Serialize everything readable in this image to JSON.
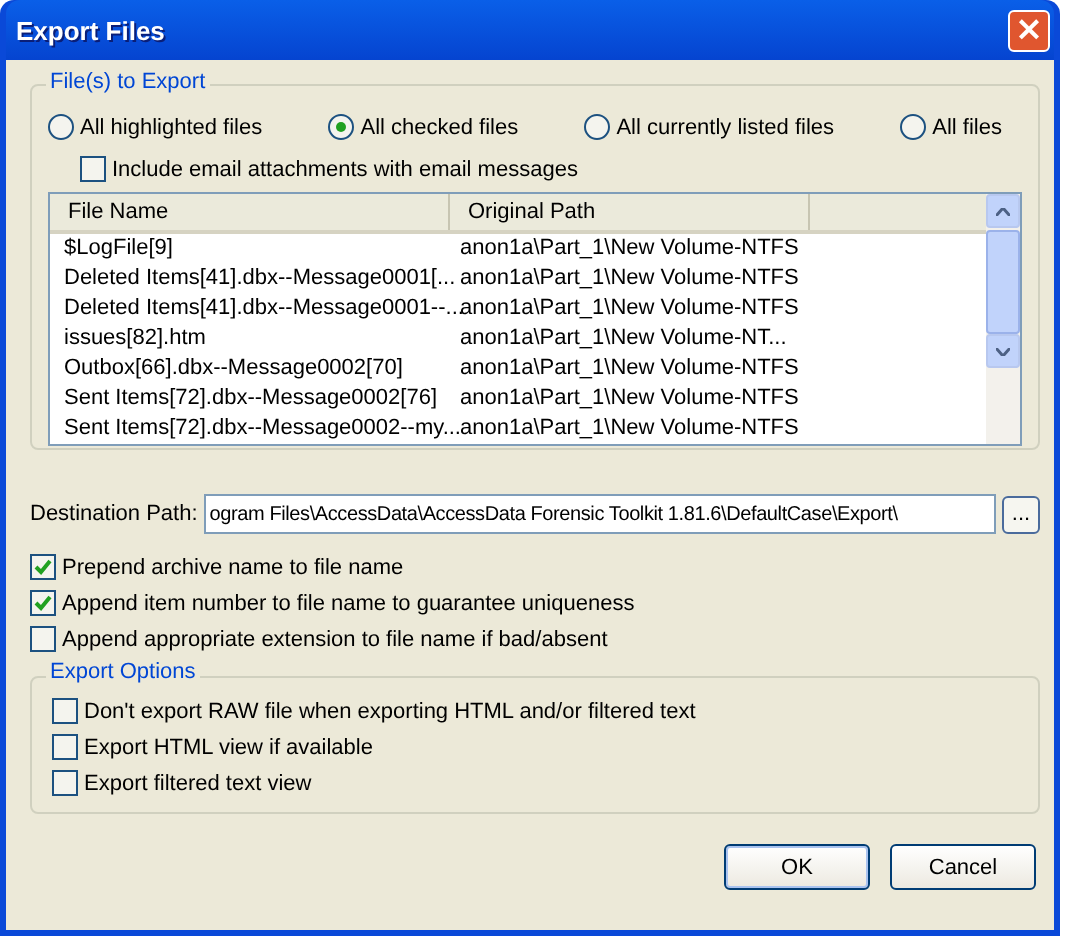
{
  "window": {
    "title": "Export Files",
    "close": "×"
  },
  "files_to_export": {
    "legend": "File(s) to Export",
    "scope": [
      {
        "label": "All highlighted files",
        "selected": false
      },
      {
        "label": "All checked files",
        "selected": true
      },
      {
        "label": "All currently listed files",
        "selected": false
      },
      {
        "label": "All files",
        "selected": false
      }
    ],
    "include_attachments": {
      "label": "Include email attachments with email messages",
      "checked": false
    },
    "table": {
      "columns": [
        "File Name",
        "Original Path"
      ],
      "rows": [
        [
          "$LogFile[9]",
          "anon1a\\Part_1\\New Volume-NTFS"
        ],
        [
          "Deleted Items[41].dbx--Message0001[...",
          "anon1a\\Part_1\\New Volume-NTFS"
        ],
        [
          "Deleted Items[41].dbx--Message0001--...",
          "anon1a\\Part_1\\New Volume-NTFS"
        ],
        [
          "issues[82].htm",
          "anon1a\\Part_1\\New Volume-NT..."
        ],
        [
          "Outbox[66].dbx--Message0002[70]",
          "anon1a\\Part_1\\New Volume-NTFS"
        ],
        [
          "Sent Items[72].dbx--Message0002[76]",
          "anon1a\\Part_1\\New Volume-NTFS"
        ],
        [
          "Sent Items[72].dbx--Message0002--my...",
          "anon1a\\Part_1\\New Volume-NTFS"
        ]
      ]
    }
  },
  "destination": {
    "label": "Destination Path:",
    "value": "ogram Files\\AccessData\\AccessData Forensic Toolkit 1.81.6\\DefaultCase\\Export\\",
    "browse": "..."
  },
  "options": [
    {
      "label": "Prepend archive name to file name",
      "checked": true
    },
    {
      "label": "Append item number to file name to guarantee uniqueness",
      "checked": true
    },
    {
      "label": "Append appropriate extension to file name if bad/absent",
      "checked": false
    }
  ],
  "export_options": {
    "legend": "Export Options",
    "items": [
      {
        "label": "Don't export RAW file when exporting HTML and/or filtered text",
        "checked": false
      },
      {
        "label": "Export HTML view if available",
        "checked": false
      },
      {
        "label": "Export filtered text view",
        "checked": false
      }
    ]
  },
  "buttons": [
    "OK",
    "Cancel"
  ]
}
